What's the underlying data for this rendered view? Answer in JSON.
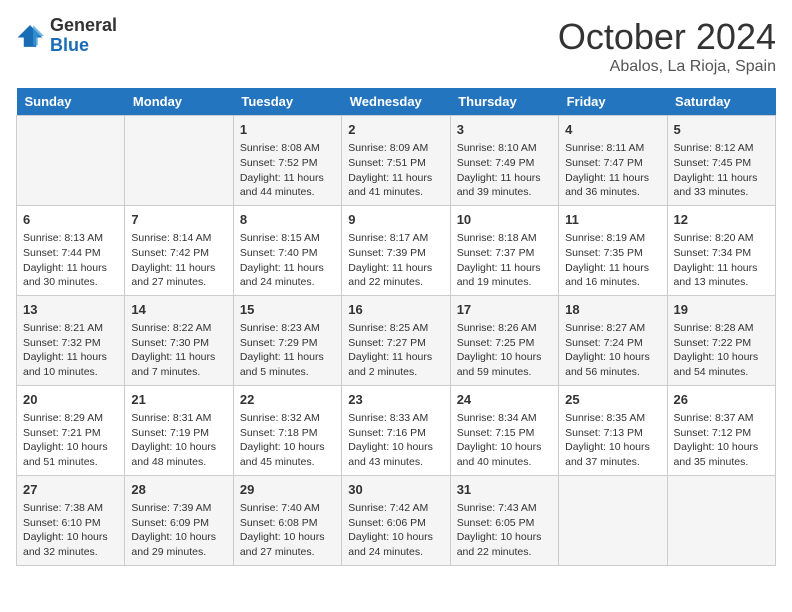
{
  "header": {
    "logo_general": "General",
    "logo_blue": "Blue",
    "month_title": "October 2024",
    "location": "Abalos, La Rioja, Spain"
  },
  "days_of_week": [
    "Sunday",
    "Monday",
    "Tuesday",
    "Wednesday",
    "Thursday",
    "Friday",
    "Saturday"
  ],
  "weeks": [
    [
      {
        "day": "",
        "content": ""
      },
      {
        "day": "",
        "content": ""
      },
      {
        "day": "1",
        "content": "Sunrise: 8:08 AM\nSunset: 7:52 PM\nDaylight: 11 hours and 44 minutes."
      },
      {
        "day": "2",
        "content": "Sunrise: 8:09 AM\nSunset: 7:51 PM\nDaylight: 11 hours and 41 minutes."
      },
      {
        "day": "3",
        "content": "Sunrise: 8:10 AM\nSunset: 7:49 PM\nDaylight: 11 hours and 39 minutes."
      },
      {
        "day": "4",
        "content": "Sunrise: 8:11 AM\nSunset: 7:47 PM\nDaylight: 11 hours and 36 minutes."
      },
      {
        "day": "5",
        "content": "Sunrise: 8:12 AM\nSunset: 7:45 PM\nDaylight: 11 hours and 33 minutes."
      }
    ],
    [
      {
        "day": "6",
        "content": "Sunrise: 8:13 AM\nSunset: 7:44 PM\nDaylight: 11 hours and 30 minutes."
      },
      {
        "day": "7",
        "content": "Sunrise: 8:14 AM\nSunset: 7:42 PM\nDaylight: 11 hours and 27 minutes."
      },
      {
        "day": "8",
        "content": "Sunrise: 8:15 AM\nSunset: 7:40 PM\nDaylight: 11 hours and 24 minutes."
      },
      {
        "day": "9",
        "content": "Sunrise: 8:17 AM\nSunset: 7:39 PM\nDaylight: 11 hours and 22 minutes."
      },
      {
        "day": "10",
        "content": "Sunrise: 8:18 AM\nSunset: 7:37 PM\nDaylight: 11 hours and 19 minutes."
      },
      {
        "day": "11",
        "content": "Sunrise: 8:19 AM\nSunset: 7:35 PM\nDaylight: 11 hours and 16 minutes."
      },
      {
        "day": "12",
        "content": "Sunrise: 8:20 AM\nSunset: 7:34 PM\nDaylight: 11 hours and 13 minutes."
      }
    ],
    [
      {
        "day": "13",
        "content": "Sunrise: 8:21 AM\nSunset: 7:32 PM\nDaylight: 11 hours and 10 minutes."
      },
      {
        "day": "14",
        "content": "Sunrise: 8:22 AM\nSunset: 7:30 PM\nDaylight: 11 hours and 7 minutes."
      },
      {
        "day": "15",
        "content": "Sunrise: 8:23 AM\nSunset: 7:29 PM\nDaylight: 11 hours and 5 minutes."
      },
      {
        "day": "16",
        "content": "Sunrise: 8:25 AM\nSunset: 7:27 PM\nDaylight: 11 hours and 2 minutes."
      },
      {
        "day": "17",
        "content": "Sunrise: 8:26 AM\nSunset: 7:25 PM\nDaylight: 10 hours and 59 minutes."
      },
      {
        "day": "18",
        "content": "Sunrise: 8:27 AM\nSunset: 7:24 PM\nDaylight: 10 hours and 56 minutes."
      },
      {
        "day": "19",
        "content": "Sunrise: 8:28 AM\nSunset: 7:22 PM\nDaylight: 10 hours and 54 minutes."
      }
    ],
    [
      {
        "day": "20",
        "content": "Sunrise: 8:29 AM\nSunset: 7:21 PM\nDaylight: 10 hours and 51 minutes."
      },
      {
        "day": "21",
        "content": "Sunrise: 8:31 AM\nSunset: 7:19 PM\nDaylight: 10 hours and 48 minutes."
      },
      {
        "day": "22",
        "content": "Sunrise: 8:32 AM\nSunset: 7:18 PM\nDaylight: 10 hours and 45 minutes."
      },
      {
        "day": "23",
        "content": "Sunrise: 8:33 AM\nSunset: 7:16 PM\nDaylight: 10 hours and 43 minutes."
      },
      {
        "day": "24",
        "content": "Sunrise: 8:34 AM\nSunset: 7:15 PM\nDaylight: 10 hours and 40 minutes."
      },
      {
        "day": "25",
        "content": "Sunrise: 8:35 AM\nSunset: 7:13 PM\nDaylight: 10 hours and 37 minutes."
      },
      {
        "day": "26",
        "content": "Sunrise: 8:37 AM\nSunset: 7:12 PM\nDaylight: 10 hours and 35 minutes."
      }
    ],
    [
      {
        "day": "27",
        "content": "Sunrise: 7:38 AM\nSunset: 6:10 PM\nDaylight: 10 hours and 32 minutes."
      },
      {
        "day": "28",
        "content": "Sunrise: 7:39 AM\nSunset: 6:09 PM\nDaylight: 10 hours and 29 minutes."
      },
      {
        "day": "29",
        "content": "Sunrise: 7:40 AM\nSunset: 6:08 PM\nDaylight: 10 hours and 27 minutes."
      },
      {
        "day": "30",
        "content": "Sunrise: 7:42 AM\nSunset: 6:06 PM\nDaylight: 10 hours and 24 minutes."
      },
      {
        "day": "31",
        "content": "Sunrise: 7:43 AM\nSunset: 6:05 PM\nDaylight: 10 hours and 22 minutes."
      },
      {
        "day": "",
        "content": ""
      },
      {
        "day": "",
        "content": ""
      }
    ]
  ]
}
